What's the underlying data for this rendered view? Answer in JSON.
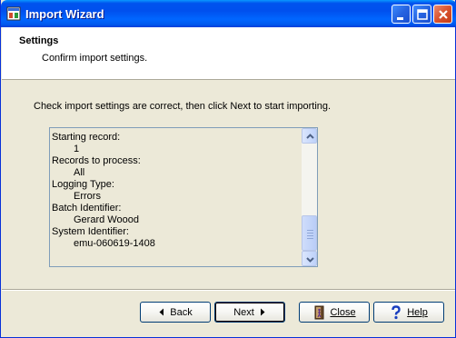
{
  "window": {
    "title": "Import Wizard"
  },
  "header": {
    "title": "Settings",
    "subtitle": "Confirm import settings."
  },
  "instruction": "Check import settings are correct, then click Next to start importing.",
  "settings": [
    {
      "text": "Starting record:",
      "indent": false
    },
    {
      "text": "1",
      "indent": true
    },
    {
      "text": "Records to process:",
      "indent": false
    },
    {
      "text": "All",
      "indent": true
    },
    {
      "text": "Logging Type:",
      "indent": false
    },
    {
      "text": "Errors",
      "indent": true
    },
    {
      "text": "Batch Identifier:",
      "indent": false
    },
    {
      "text": "Gerard Woood",
      "indent": true
    },
    {
      "text": "System Identifier:",
      "indent": false
    },
    {
      "text": "emu-060619-1408",
      "indent": true
    }
  ],
  "buttons": {
    "back": "Back",
    "next": "Next",
    "close": "Close",
    "help": "Help"
  },
  "colors": {
    "titlebar": "#0055ea",
    "face": "#ece9d8",
    "button_border": "#003c74"
  }
}
